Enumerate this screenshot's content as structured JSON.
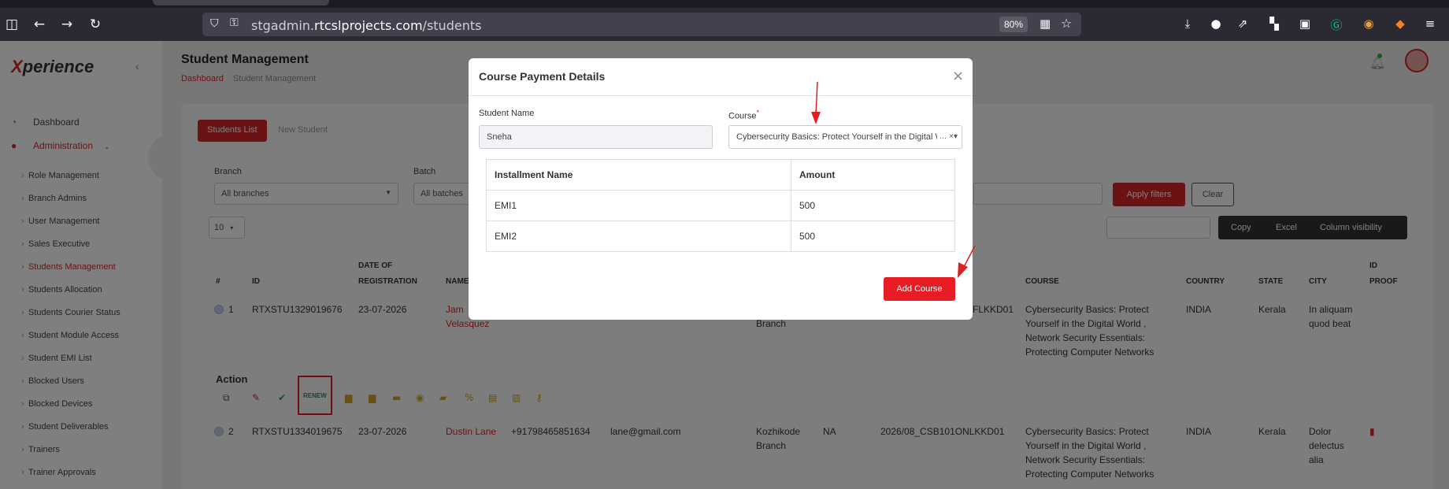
{
  "browser": {
    "url_host_prefix": "stgadmin.",
    "url_host_main": "rtcslprojects.com",
    "url_path": "/students",
    "zoom": "80%"
  },
  "sidebar": {
    "logo_x": "X",
    "logo_rest": "perience",
    "items": [
      {
        "label": "Dashboard",
        "icon": "dashboard-icon"
      },
      {
        "label": "Administration",
        "icon": "user-icon"
      }
    ],
    "sub_items": [
      "Role Management",
      "Branch Admins",
      "User Management",
      "Sales Executive",
      "Students Management",
      "Students Allocation",
      "Students Courier Status",
      "Student Module Access",
      "Student EMI List",
      "Blocked Users",
      "Blocked Devices",
      "Student Deliverables",
      "Trainers",
      "Trainer Approvals"
    ]
  },
  "header": {
    "title": "Student Management",
    "breadcrumb_home": "Dashboard",
    "breadcrumb_current": "Student Management"
  },
  "tabs": {
    "list": "Students List",
    "new": "New Student"
  },
  "filters": {
    "branch_label": "Branch",
    "branch_value": "All branches",
    "batch_label": "Batch",
    "batch_value": "All batches",
    "apply": "Apply filters",
    "clear": "Clear",
    "page_length": "10"
  },
  "table_buttons": {
    "copy": "Copy",
    "excel": "Excel",
    "column_visibility": "Column visibility"
  },
  "columns": {
    "num": "#",
    "id": "ID",
    "date_top": "DATE OF",
    "date_bottom": "REGISTRATION",
    "name": "NAME",
    "course": "COURSE",
    "country": "COUNTRY",
    "state": "STATE",
    "city": "CITY",
    "idproof_top": "ID",
    "idproof_bottom": "PROOF"
  },
  "rows": [
    {
      "num": "1",
      "id": "RTXSTU1329019676",
      "date": "23-07-2026",
      "name_line1": "Jam",
      "name_line2": "Velasquez",
      "branch_fragment": "Branch",
      "code_fragment": "FLKKD01",
      "course_lines": [
        "Cybersecurity Basics: Protect",
        "Yourself in the Digital World ,",
        "Network Security Essentials:",
        "Protecting Computer Networks"
      ],
      "country": "INDIA",
      "state": "Kerala",
      "city_lines": [
        "In aliquam",
        "quod beat"
      ]
    },
    {
      "num": "2",
      "id": "RTXSTU1334019675",
      "date": "23-07-2026",
      "name": "Dustin Lane",
      "phone": "+91798465851634",
      "email": "lane@gmail.com",
      "branch_line1": "Kozhikode",
      "branch_line2": "Branch",
      "na": "NA",
      "code": "2026/08_CSB101ONLKKD01",
      "course_lines": [
        "Cybersecurity Basics: Protect",
        "Yourself in the Digital World ,",
        "Network Security Essentials:",
        "Protecting Computer Networks"
      ],
      "country": "INDIA",
      "state": "Kerala",
      "city_lines": [
        "Dolor",
        "delectus",
        "alia"
      ]
    }
  ],
  "action": {
    "label": "Action",
    "renew": "RENEW"
  },
  "modal": {
    "title": "Course Payment Details",
    "close": "×",
    "student_name_label": "Student Name",
    "student_name_value": "Sneha",
    "course_label": "Course",
    "required_mark": "*",
    "course_value": "Cybersecurity Basics: Protect Yourself in the Digital World",
    "course_clear": "×",
    "course_caret": "▾",
    "table_headers": [
      "Installment Name",
      "Amount"
    ],
    "installments": [
      {
        "name": "EMI1",
        "amount": "500"
      },
      {
        "name": "EMI2",
        "amount": "500"
      }
    ],
    "add_button": "Add Course"
  },
  "colors": {
    "brand": "#d6252a",
    "annotation_arrow": "#e02020"
  }
}
